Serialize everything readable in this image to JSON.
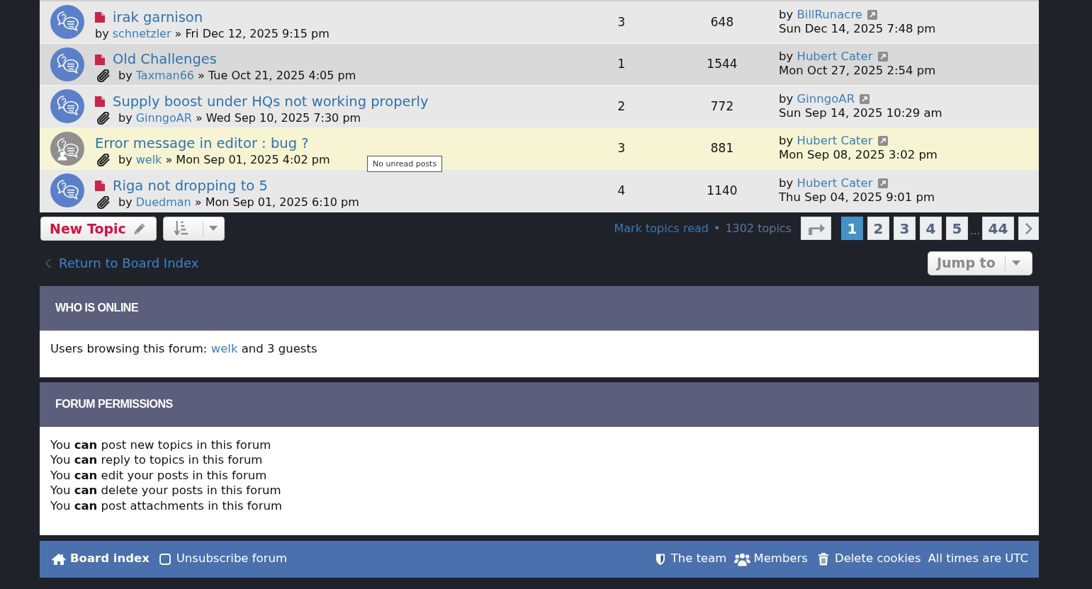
{
  "topics": [
    {
      "title": "irak garnison",
      "unread": true,
      "posted_by_me": false,
      "attachment": false,
      "hovered": false,
      "by": "by",
      "author": "schnetzler",
      "started": "» Fri Dec 12, 2025 9:15 pm",
      "replies": "3",
      "views": "648",
      "last_post": {
        "by": "by",
        "author": "BillRunacre",
        "time": "Sun Dec 14, 2025 7:48 pm"
      }
    },
    {
      "title": "Old Challenges",
      "unread": true,
      "posted_by_me": false,
      "attachment": true,
      "hovered": false,
      "by": "by",
      "author": "Taxman66",
      "started": "» Tue Oct 21, 2025 4:05 pm",
      "replies": "1",
      "views": "1544",
      "last_post": {
        "by": "by",
        "author": "Hubert Cater",
        "time": "Mon Oct 27, 2025 2:54 pm"
      }
    },
    {
      "title": "Supply boost under HQs not working properly",
      "unread": true,
      "posted_by_me": false,
      "attachment": true,
      "hovered": false,
      "by": "by",
      "author": "GinngoAR",
      "started": "» Wed Sep 10, 2025 7:30 pm",
      "replies": "2",
      "views": "772",
      "last_post": {
        "by": "by",
        "author": "GinngoAR",
        "time": "Sun Sep 14, 2025 10:29 am"
      }
    },
    {
      "title": "Error message in editor : bug ?",
      "unread": false,
      "posted_by_me": true,
      "attachment": true,
      "hovered": true,
      "by": "by",
      "author": "welk",
      "started": "» Mon Sep 01, 2025 4:02 pm",
      "replies": "3",
      "views": "881",
      "last_post": {
        "by": "by",
        "author": "Hubert Cater",
        "time": "Mon Sep 08, 2025 3:02 pm"
      }
    },
    {
      "title": "Riga not dropping to 5",
      "unread": true,
      "posted_by_me": false,
      "attachment": true,
      "hovered": false,
      "by": "by",
      "author": "Duedman",
      "started": "» Mon Sep 01, 2025 6:10 pm",
      "replies": "4",
      "views": "1140",
      "last_post": {
        "by": "by",
        "author": "Hubert Cater",
        "time": "Thu Sep 04, 2025 9:01 pm"
      }
    }
  ],
  "tooltip": {
    "text": "No unread posts"
  },
  "actions": {
    "new_topic": "New Topic"
  },
  "pagination": {
    "mark_read": "Mark topics read",
    "separator": "•",
    "count": "1302 topics",
    "pages": [
      {
        "label": "1",
        "selected": true
      },
      {
        "label": "2",
        "selected": false
      },
      {
        "label": "3",
        "selected": false
      },
      {
        "label": "4",
        "selected": false
      },
      {
        "label": "5",
        "selected": false
      }
    ],
    "ellipsis": "…",
    "last_page": {
      "label": "44",
      "selected": false
    }
  },
  "return_link": "Return to Board Index",
  "jump_to": "Jump to",
  "who_is_online": {
    "title": "WHO IS ONLINE",
    "text_before": "Users browsing this forum:",
    "user": "welk",
    "text_after": "and 3 guests"
  },
  "forum_permissions": {
    "title": "FORUM PERMISSIONS",
    "lines": [
      "You **can** post new topics in this forum",
      "You **can** reply to topics in this forum",
      "You **can** edit your posts in this forum",
      "You **can** delete your posts in this forum",
      "You **can** post attachments in this forum"
    ]
  },
  "footer": {
    "board_index": "Board index",
    "unsubscribe": "Unsubscribe forum",
    "team": "The team",
    "members": "Members",
    "delete_cookies": "Delete cookies",
    "timezone": "All times are UTC"
  }
}
